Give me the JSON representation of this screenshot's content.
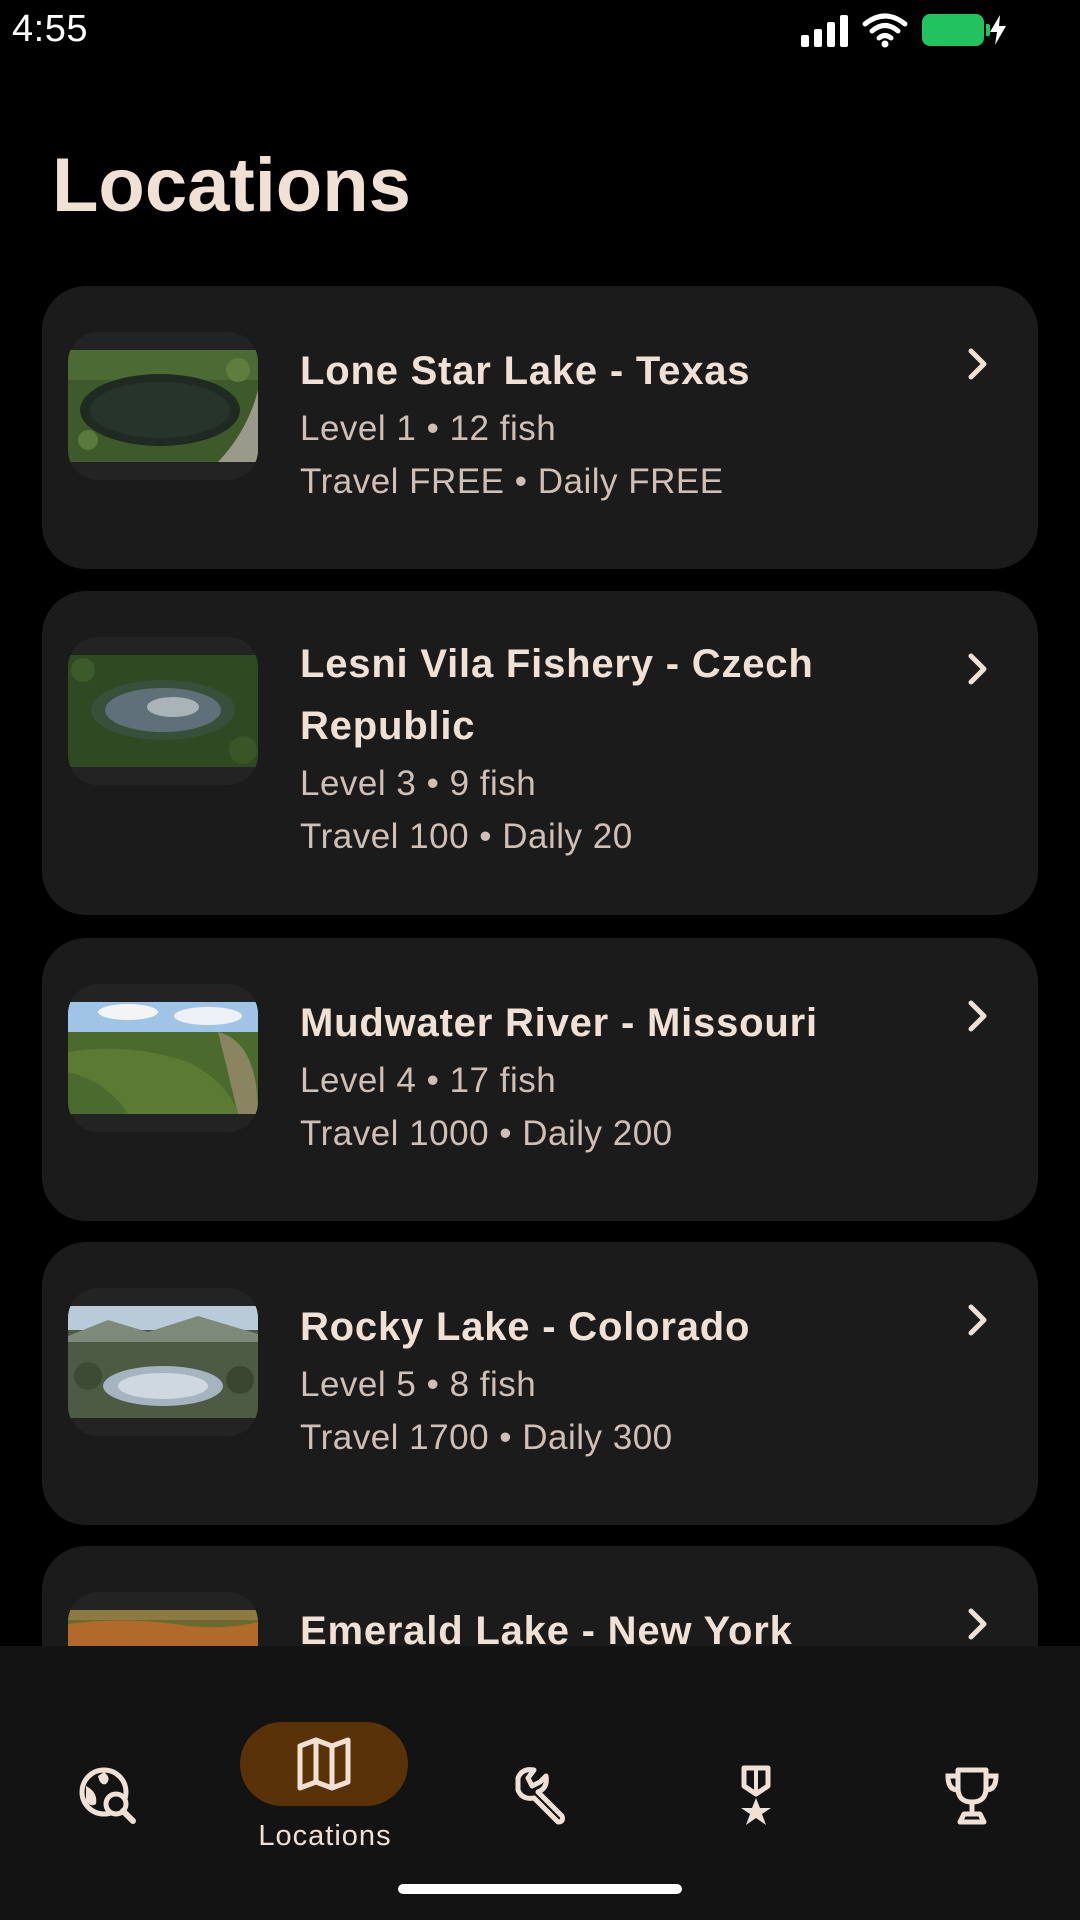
{
  "status_bar": {
    "time": "4:55"
  },
  "header": {
    "title": "Locations"
  },
  "locations": [
    {
      "name": "Lone Star Lake - Texas",
      "stats": "Level 1 • 12 fish",
      "costs": "Travel FREE • Daily FREE"
    },
    {
      "name": "Lesni Vila Fishery - Czech Republic",
      "stats": "Level 3 • 9 fish",
      "costs": "Travel 100 • Daily 20"
    },
    {
      "name": "Mudwater River - Missouri",
      "stats": "Level 4 • 17 fish",
      "costs": "Travel 1000 • Daily 200"
    },
    {
      "name": "Rocky Lake - Colorado",
      "stats": "Level 5 • 8 fish",
      "costs": "Travel 1700 • Daily 300"
    },
    {
      "name": "Emerald Lake - New York",
      "stats": "",
      "costs": ""
    }
  ],
  "bottom_nav": {
    "items": [
      {
        "icon": "globe-search-icon",
        "label": ""
      },
      {
        "icon": "map-icon",
        "label": "Locations",
        "active": true
      },
      {
        "icon": "wrench-icon",
        "label": ""
      },
      {
        "icon": "medal-icon",
        "label": ""
      },
      {
        "icon": "trophy-icon",
        "label": ""
      }
    ]
  },
  "colors": {
    "background": "#000000",
    "card": "#1b1b1b",
    "text_primary": "#f1e0d4",
    "text_secondary": "#cfbfb4",
    "nav_active_pill": "#5a3208",
    "battery": "#22c35e"
  }
}
